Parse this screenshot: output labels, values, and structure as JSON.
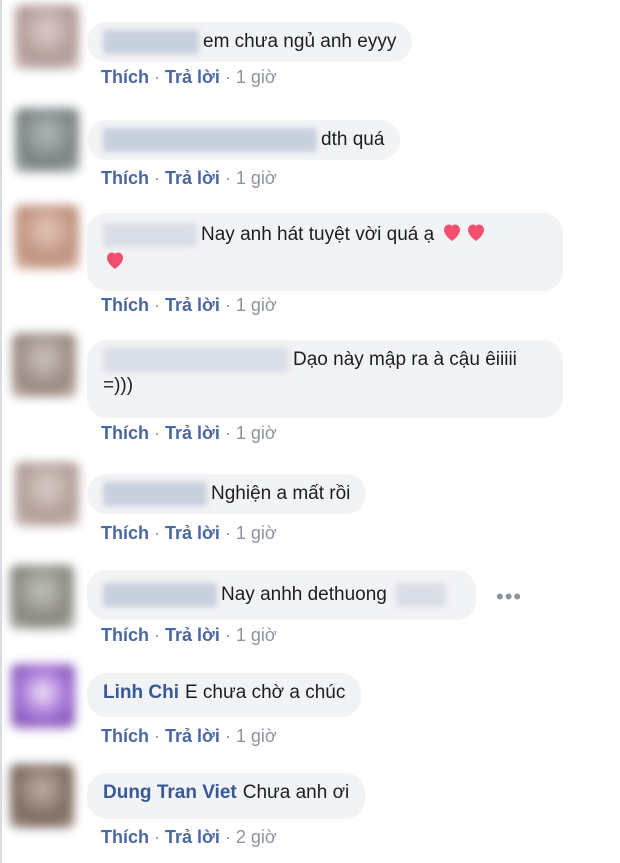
{
  "comments": [
    {
      "author": "",
      "text": "em chưa ngủ anh eyyy",
      "like": "Thích",
      "reply": "Trả lời",
      "time": "1 giờ"
    },
    {
      "author": "",
      "text": "dth quá",
      "like": "Thích",
      "reply": "Trả lời",
      "time": "1 giờ"
    },
    {
      "author": "",
      "text": "Nay anh hát tuyệt vời quá ạ",
      "like": "Thích",
      "reply": "Trả lời",
      "time": "1 giờ"
    },
    {
      "author": "",
      "text": "Dạo này mập ra à cậu êiiiii",
      "text2": "=)))",
      "like": "Thích",
      "reply": "Trả lời",
      "time": "1 giờ"
    },
    {
      "author": "",
      "text": "Nghiện a mất rồi",
      "like": "Thích",
      "reply": "Trả lời",
      "time": "1 giờ"
    },
    {
      "author": "",
      "text": "Nay anhh dethuong",
      "like": "Thích",
      "reply": "Trả lời",
      "time": "1 giờ"
    },
    {
      "author": "Linh Chi",
      "text": "E chưa chờ a chúc",
      "like": "Thích",
      "reply": "Trả lời",
      "time": "1 giờ"
    },
    {
      "author": "Dung Tran Viet",
      "text": "Chưa anh ơi",
      "like": "Thích",
      "reply": "Trả lời",
      "time": "2 giờ"
    }
  ],
  "separator": "·",
  "more_label": "•••",
  "colors": {
    "link": "#4b67a1",
    "author": "#385898",
    "bubble": "#f2f3f5",
    "meta": "#8d949e",
    "heart": "#f0506e"
  },
  "icons": {
    "heart": "heart-icon",
    "more": "more-options-icon"
  }
}
